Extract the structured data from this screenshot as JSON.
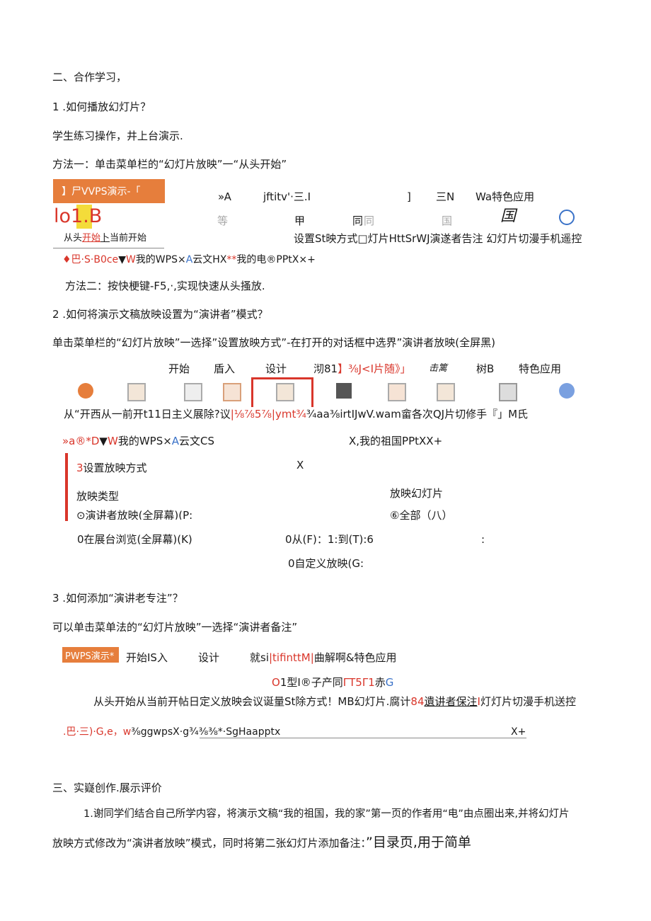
{
  "section2": {
    "heading": "二、合作学习，",
    "q1": "1 .如何播放幻灯片？",
    "q1_line1": "学生练习操作，井上台演示.",
    "q1_line2": "方法一：单击菜单栏的“幻灯片放映”一“从头开始”",
    "shot1": {
      "app_title": "】尸VVPS演示-「",
      "tab_a": "»A",
      "tab_b": "jftitv'·三.I",
      "tab_c": "]",
      "tab_d": "三N",
      "tab_e": "Wa特色应用",
      "big_logo": "lo1.B",
      "grey1": "等",
      "grey2": "甲",
      "grey3a": "同",
      "grey3b": "同",
      "grey4": "国",
      "icon_glyph": "国",
      "from_start_a": "从头",
      "from_start_b": "开始",
      "from_start_c": "卜",
      "from_start_d": "当前开始",
      "ribbon_text": "设置St映方式□灯片HttSrWJ演遂者告注  幻灯片切漫手机遥控",
      "status_a": "♦巴·",
      "status_b": "S·B0ce",
      "status_c": "▼",
      "status_d": "W",
      "status_e": "我的WPS×",
      "status_f": "A",
      "status_g": "云文HX",
      "status_h": "**",
      "status_i": "我的电®PPtX×+"
    },
    "method2": "方法二：按快梗键-F5,·,实现快速从头搔放.",
    "q2": "2  .如何将演示文稿放映设置为“演讲者”模式？",
    "q2_line1": "单击菜单栏的“幻灯片放映”一选择”设置放映方式”-在打开的对话框中选界”演讲者放映(全屏黑)",
    "shot2": {
      "tab1": "开始",
      "tab2": "盾入",
      "tab3": "设计",
      "tab4a": "沏81",
      "tab4b": "】⅜J<I片随》」",
      "tab5": "击篱",
      "tab6": "树B",
      "tab7": "特色应用",
      "ribbon_a": "从“开西从一前开t11日主义展除?议",
      "ribbon_b": "|⅛⅞5⅞|ymt¾",
      "ribbon_c": "¾aa⅜irtIJwV.wam畲各次QJ片切修手『」M氏",
      "status_a": "»a®*D",
      "status_b": "▼",
      "status_c": "W",
      "status_d": "我的WPS×",
      "status_e": "A",
      "status_f": "云文CS",
      "status_g": "X,",
      "status_h": "我的祖国PPtXX+",
      "close_x": "X",
      "dialog_num": "3",
      "dialog_title": "设置放映方式",
      "type_label": "放映类型",
      "range_label": "放映幻灯片",
      "opt_speaker": "⊙演讲者放映(全屏幕)(P:",
      "opt_all": "⑥全部（八）",
      "opt_kiosk": "0在展台浏览(全屏幕)(K)",
      "opt_from": "0从(F)：1:到(T):6",
      "colon": ":",
      "opt_custom": "0自定义放映(G:"
    },
    "q3": "3  .如何添加“演讲老专注”？",
    "q3_line1": "可以单击菜单法的“幻灯片放映”一选择“演讲者备注”",
    "shot3": {
      "app_title": "PWPS演示*",
      "tabs_a": "开始IS入",
      "tabs_b": "设计",
      "tabs_c": "就si",
      "tabs_d": "|tifinttM|",
      "tabs_e": "曲解啊&特色应用",
      "row2_a": "O",
      "row2_b": "1型I®子产同",
      "row2_c": "ΓT5Γ1",
      "row2_d": "赤",
      "row2_e": "G",
      "ribbon_a": "从头开始从当前开帖日定义放映会议诞量St除方式！MB幻灯片.腐计",
      "ribbon_b": "84",
      "ribbon_c": "遺讲者保注",
      "ribbon_d": "I",
      "ribbon_e": "灯灯片切漫手机送控",
      "status_a": ".巴·三)·G,e",
      "status_b": "，w",
      "status_c": "⅜ggwpsX·g¾⅜⅜*·",
      "status_d": "SgHaapptx",
      "close": "X+"
    }
  },
  "section3": {
    "heading": "三、实嶷创作.展示评价",
    "para1": "1.谢同学们结合自己所学内容，将演示文稿“我的祖国，我的家”第一页的作者用“电”由点圈出来,并将幻灯片",
    "para2a": "放映方式修改为“演讲者放映”模式，同时将第二张幻灯片添加备注：",
    "para2b": "”目录页,用于简单"
  },
  "icons": [
    "play-icon",
    "projector-icon",
    "screen-icon",
    "grid-icon",
    "settings-projector-icon",
    "slide-icon",
    "image-icon",
    "presenter-icon",
    "phone-icon",
    "remote-icon"
  ],
  "colors": {
    "accent_orange": "#e67e3c",
    "accent_red": "#d9362b",
    "highlight_yellow": "#f4dc3a",
    "accent_blue": "#3a72c8"
  }
}
